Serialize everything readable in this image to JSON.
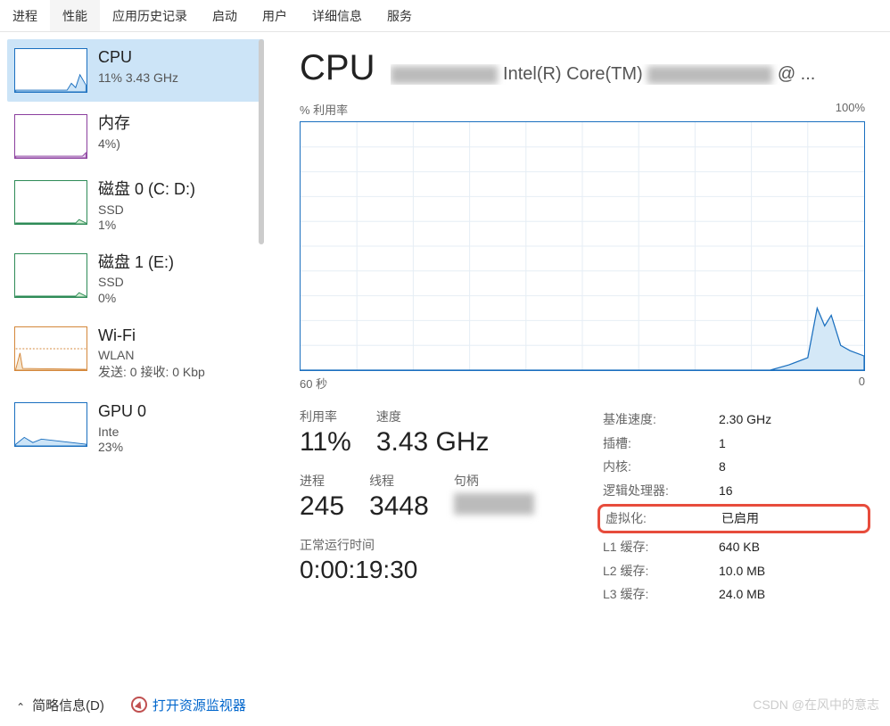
{
  "tabs": [
    "进程",
    "性能",
    "应用历史记录",
    "启动",
    "用户",
    "详细信息",
    "服务"
  ],
  "activeTab": 1,
  "sidebar": [
    {
      "title": "CPU",
      "sub": "11%  3.43 GHz",
      "type": "cpu"
    },
    {
      "title": "内存",
      "sub": "4%)",
      "type": "mem"
    },
    {
      "title": "磁盘 0 (C: D:)",
      "sub": "SSD",
      "sub2": "1%",
      "type": "disk"
    },
    {
      "title": "磁盘 1 (E:)",
      "sub": "SSD",
      "sub2": "0%",
      "type": "disk"
    },
    {
      "title": "Wi-Fi",
      "sub": "WLAN",
      "sub2": "发送: 0  接收: 0 Kbp",
      "type": "wifi"
    },
    {
      "title": "GPU 0",
      "sub": "Inte",
      "sub2": "23%",
      "type": "gpu"
    }
  ],
  "main": {
    "title": "CPU",
    "model_left": "Intel(R) Core(TM)",
    "model_right": "@ ...",
    "chart_top_left": "% 利用率",
    "chart_top_right": "100%",
    "chart_bottom_left": "60 秒",
    "chart_bottom_right": "0",
    "big": [
      {
        "label": "利用率",
        "value": "11%"
      },
      {
        "label": "速度",
        "value": "3.43 GHz"
      }
    ],
    "big2": [
      {
        "label": "进程",
        "value": "245"
      },
      {
        "label": "线程",
        "value": "3448"
      },
      {
        "label": "句柄",
        "value": ""
      }
    ],
    "uptime_label": "正常运行时间",
    "uptime_value": "0:00:19:30",
    "specs": [
      {
        "k": "基准速度:",
        "v": "2.30 GHz"
      },
      {
        "k": "插槽:",
        "v": "1"
      },
      {
        "k": "内核:",
        "v": "8"
      },
      {
        "k": "逻辑处理器:",
        "v": "16"
      },
      {
        "k": "虚拟化:",
        "v": "已启用",
        "highlight": true
      },
      {
        "k": "L1 缓存:",
        "v": "640 KB"
      },
      {
        "k": "L2 缓存:",
        "v": "10.0 MB"
      },
      {
        "k": "L3 缓存:",
        "v": "24.0 MB"
      }
    ]
  },
  "bottom": {
    "brief": "简略信息(D)",
    "resmon": "打开资源监视器"
  },
  "watermark": "CSDN @在风中的意志",
  "chart_data": {
    "type": "area",
    "title": "% 利用率",
    "xlabel": "60 秒",
    "ylabel": "% 利用率",
    "ylim": [
      0,
      100
    ],
    "x_seconds_ago": [
      60,
      55,
      50,
      45,
      40,
      35,
      30,
      25,
      20,
      15,
      10,
      8,
      6,
      5,
      4,
      3,
      2,
      1,
      0
    ],
    "values_pct": [
      0,
      0,
      0,
      0,
      0,
      0,
      0,
      0,
      0,
      0,
      0,
      2,
      5,
      25,
      18,
      22,
      10,
      8,
      6
    ]
  }
}
